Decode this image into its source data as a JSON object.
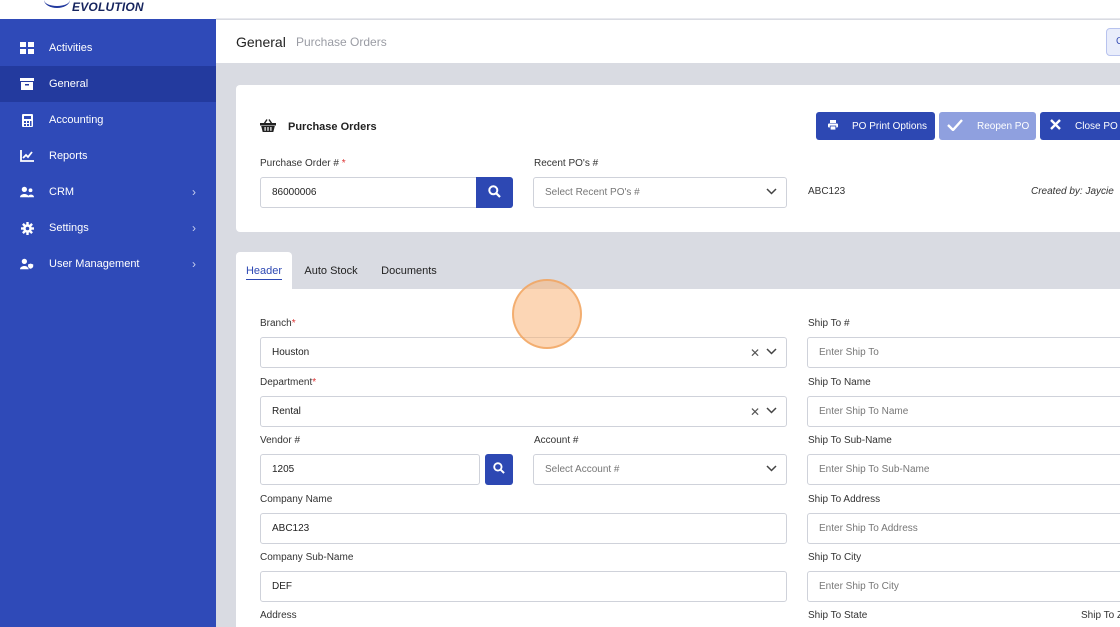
{
  "app": {
    "logo": "EVOLUTION"
  },
  "sidebar": {
    "items": [
      {
        "label": "Activities",
        "icon": "grid-icon",
        "active": false,
        "chevron": false
      },
      {
        "label": "General",
        "icon": "archive-box-icon",
        "active": true,
        "chevron": false
      },
      {
        "label": "Accounting",
        "icon": "calculator-icon",
        "active": false,
        "chevron": false
      },
      {
        "label": "Reports",
        "icon": "line-chart-icon",
        "active": false,
        "chevron": false
      },
      {
        "label": "CRM",
        "icon": "users-icon",
        "active": false,
        "chevron": true
      },
      {
        "label": "Settings",
        "icon": "gear-icon",
        "active": false,
        "chevron": true
      },
      {
        "label": "User Management",
        "icon": "user-shield-icon",
        "active": false,
        "chevron": true
      }
    ]
  },
  "breadcrumb": {
    "main": "General",
    "sub": "Purchase Orders",
    "top_button": "C"
  },
  "po": {
    "title": "Purchase Orders",
    "buttons": {
      "print": "PO Print Options",
      "reopen": "Reopen PO",
      "close": "Close PO"
    },
    "po_number_label": "Purchase Order #",
    "po_number_value": "86000006",
    "recent_label": "Recent PO's #",
    "recent_placeholder": "Select Recent PO's #",
    "company_code": "ABC123",
    "created_by": "Created by: Jaycie"
  },
  "tabs": [
    {
      "label": "Header"
    },
    {
      "label": "Auto Stock"
    },
    {
      "label": "Documents"
    }
  ],
  "form": {
    "branch_label": "Branch",
    "branch_value": "Houston",
    "department_label": "Department",
    "department_value": "Rental",
    "vendor_label": "Vendor #",
    "vendor_value": "1205",
    "account_label": "Account #",
    "account_placeholder": "Select Account #",
    "company_name_label": "Company Name",
    "company_name_value": "ABC123",
    "company_sub_label": "Company Sub-Name",
    "company_sub_value": "DEF",
    "address_label": "Address",
    "ship_to_label": "Ship To #",
    "ship_to_placeholder": "Enter Ship To",
    "ship_name_label": "Ship To Name",
    "ship_name_placeholder": "Enter Ship To Name",
    "ship_sub_label": "Ship To Sub-Name",
    "ship_sub_placeholder": "Enter Ship To Sub-Name",
    "ship_address_label": "Ship To Address",
    "ship_address_placeholder": "Enter Ship To Address",
    "ship_city_label": "Ship To City",
    "ship_city_placeholder": "Enter Ship To City",
    "ship_state_label": "Ship To State",
    "ship_zip_label": "Ship To Z"
  },
  "colors": {
    "sidebar": "#2f4ab8",
    "sidebar_active": "#233a9e",
    "primary": "#2d48b3",
    "disabled": "#8fa0df"
  }
}
